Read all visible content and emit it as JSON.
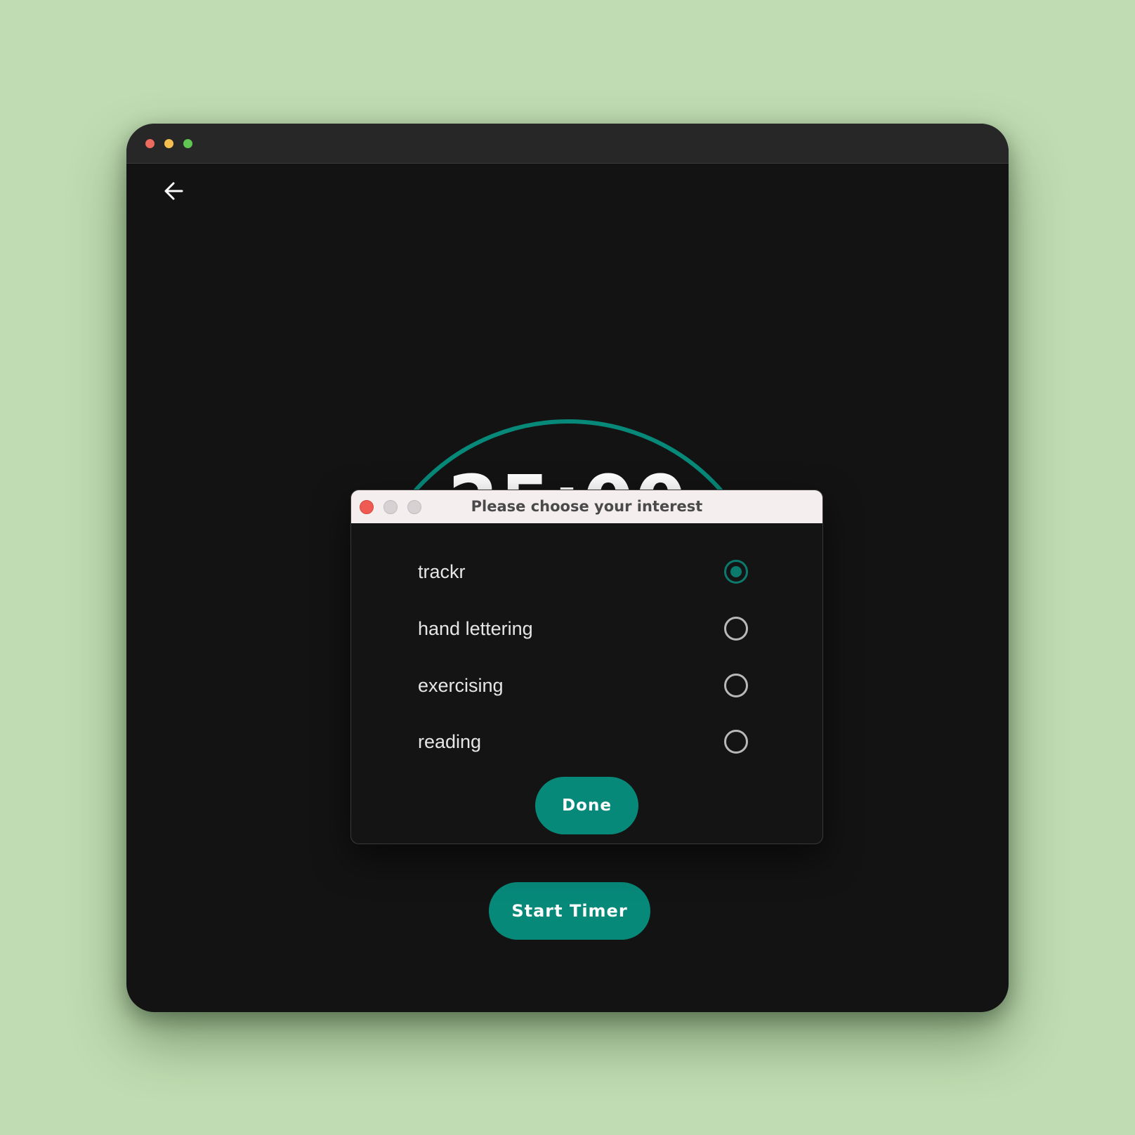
{
  "app": {
    "timer_value": "25:00",
    "start_button_label": "Start Timer",
    "accent_color": "#07897a"
  },
  "dialog": {
    "title": "Please choose your interest",
    "options": [
      {
        "label": "trackr",
        "selected": true
      },
      {
        "label": "hand lettering",
        "selected": false
      },
      {
        "label": "exercising",
        "selected": false
      },
      {
        "label": "reading",
        "selected": false
      }
    ],
    "done_label": "Done"
  },
  "icons": {
    "back": "arrow-left-icon",
    "radio_selected": "radio-checked-icon",
    "radio_unselected": "radio-unchecked-icon"
  }
}
